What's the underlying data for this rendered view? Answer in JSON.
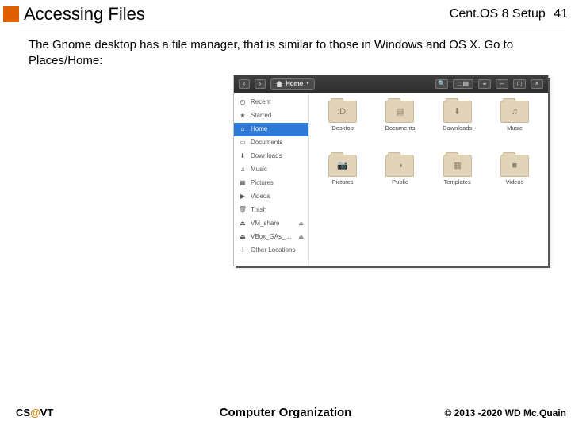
{
  "header": {
    "title": "Accessing Files",
    "course": "Cent.OS 8 Setup",
    "page_no": "41"
  },
  "body": {
    "text": "The Gnome desktop has a file manager, that is similar to those in Windows and OS X.  Go to Places/Home:"
  },
  "fm": {
    "path_label": "Home",
    "sidebar": [
      {
        "icon": "◴",
        "label": "Recent",
        "sel": false
      },
      {
        "icon": "★",
        "label": "Starred",
        "sel": false
      },
      {
        "icon": "⌂",
        "label": "Home",
        "sel": true
      },
      {
        "icon": "▭",
        "label": "Documents",
        "sel": false
      },
      {
        "icon": "⬇",
        "label": "Downloads",
        "sel": false
      },
      {
        "icon": "♫",
        "label": "Music",
        "sel": false
      },
      {
        "icon": "▦",
        "label": "Pictures",
        "sel": false
      },
      {
        "icon": "▶",
        "label": "Videos",
        "sel": false
      },
      {
        "icon": "🗑",
        "label": "Trash",
        "sel": false
      },
      {
        "icon": "⏏",
        "label": "VM_share",
        "sel": false,
        "eject": true
      },
      {
        "icon": "⏏",
        "label": "VBox_GAs_6…",
        "sel": false,
        "eject": true
      },
      {
        "icon": "＋",
        "label": "Other Locations",
        "sel": false
      }
    ],
    "folders": [
      {
        "glyph": ":D:",
        "label": "Desktop"
      },
      {
        "glyph": "▤",
        "label": "Documents"
      },
      {
        "glyph": "⬇",
        "label": "Downloads"
      },
      {
        "glyph": "♫",
        "label": "Music"
      },
      {
        "glyph": "📷",
        "label": "Pictures"
      },
      {
        "glyph": "◑",
        "label": "Public"
      },
      {
        "glyph": "▦",
        "label": "Templates"
      },
      {
        "glyph": "■",
        "label": "Videos"
      }
    ]
  },
  "footer": {
    "left_pre": "CS",
    "left_at": "@",
    "left_post": "VT",
    "center": "Computer Organization",
    "right": "© 2013 -2020 WD Mc.Quain"
  }
}
